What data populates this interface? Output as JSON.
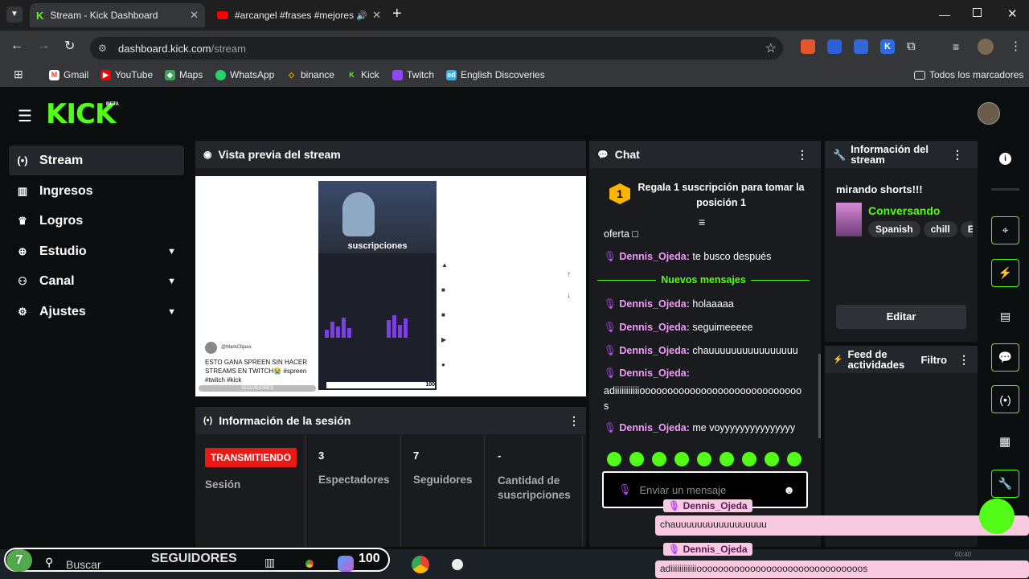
{
  "browser": {
    "tabs": [
      {
        "title": "Stream - Kick Dashboard",
        "active": true,
        "icon": "kick-icon"
      },
      {
        "title": "#arcangel #frases #mejores",
        "active": false,
        "icon": "youtube-icon"
      }
    ],
    "new_tab": "+",
    "url_host": "dashboard.kick.com",
    "url_path": "/stream",
    "bookmarks": [
      {
        "label": "Gmail",
        "icon": "gmail-icon",
        "color": "#ea4335"
      },
      {
        "label": "YouTube",
        "icon": "youtube-icon",
        "color": "#ff0000"
      },
      {
        "label": "Maps",
        "icon": "maps-icon",
        "color": "#34a853"
      },
      {
        "label": "WhatsApp",
        "icon": "whatsapp-icon",
        "color": "#25d366"
      },
      {
        "label": "binance",
        "icon": "binance-icon",
        "color": "#f0b90b"
      },
      {
        "label": "Kick",
        "icon": "kick-icon",
        "color": "#53fc18"
      },
      {
        "label": "Twitch",
        "icon": "twitch-icon",
        "color": "#9146ff"
      },
      {
        "label": "English Discoveries",
        "icon": "ed-icon",
        "color": "#3ab0e2"
      }
    ],
    "all_bookmarks": "Todos los marcadores"
  },
  "app": {
    "logo": "KICK",
    "logo_badge": "BETA",
    "accent": "#53fc18",
    "nav": [
      {
        "label": "Stream",
        "icon": "broadcast-icon",
        "active": true,
        "expandable": false
      },
      {
        "label": "Ingresos",
        "icon": "chart-icon",
        "active": false,
        "expandable": false
      },
      {
        "label": "Logros",
        "icon": "trophy-icon",
        "active": false,
        "expandable": false
      },
      {
        "label": "Estudio",
        "icon": "studio-icon",
        "active": false,
        "expandable": true
      },
      {
        "label": "Canal",
        "icon": "channel-icon",
        "active": false,
        "expandable": true
      },
      {
        "label": "Ajustes",
        "icon": "gear-icon",
        "active": false,
        "expandable": true
      }
    ]
  },
  "preview": {
    "title": "Vista previa del stream",
    "video_caption": "suscripciones",
    "post_user": "@MarkCbjaxx",
    "post_text": "ESTO GANA SPREEN SIN HACER STREAMS EN TWITCH😭 #spreen #twitch #kick",
    "followers_tag": "SEGUIDORES",
    "count_100": "100"
  },
  "session": {
    "title": "Información de la sesión",
    "live_badge": "TRANSMITIENDO",
    "session_label": "Sesión",
    "stats": [
      {
        "value": "3",
        "label": "Espectadores"
      },
      {
        "value": "7",
        "label": "Seguidores"
      },
      {
        "value": "-",
        "label": "Cantidad de suscripciones"
      }
    ]
  },
  "chat": {
    "title": "Chat",
    "gift_rank": "1",
    "gift_text": "Regala 1 suscripción para tomar la posición 1",
    "partial_line": "oferta □",
    "new_messages": "Nuevos mensajes",
    "messages": [
      {
        "user": "Dennis_Ojeda:",
        "text": " te busco después"
      },
      {
        "user": "Dennis_Ojeda:",
        "text": " holaaaaa"
      },
      {
        "user": "Dennis_Ojeda:",
        "text": " seguimeeeee"
      },
      {
        "user": "Dennis_Ojeda:",
        "text": " chauuuuuuuuuuuuuuuu"
      },
      {
        "user": "Dennis_Ojeda:",
        "text": "adiiiiiiiiiiiooooooooooooooooooooooooooooos"
      },
      {
        "user": "Dennis_Ojeda:",
        "text": " me voyyyyyyyyyyyyyyy"
      }
    ],
    "input_placeholder": "Enviar un mensaje"
  },
  "stream_info": {
    "title": "Información del stream",
    "stream_title": "mirando shorts!!!",
    "category": "Conversando",
    "tags": [
      "Spanish",
      "chill",
      "E"
    ],
    "edit": "Editar"
  },
  "activity": {
    "title": "Feed de actividades",
    "filter": "Filtro"
  },
  "overlay": {
    "alerts": [
      {
        "user": "Dennis_Ojeda",
        "text": "chauuuuuuuuuuuuuuuuu"
      },
      {
        "user": "Dennis_Ojeda",
        "text": "adiiiiiiiiiiiiooooooooooooooooooooooooooooooos"
      }
    ],
    "time": "00:40"
  },
  "taskbar": {
    "badge": "7",
    "search": "Buscar",
    "seguidores": "SEGUIDORES",
    "count": "100"
  }
}
